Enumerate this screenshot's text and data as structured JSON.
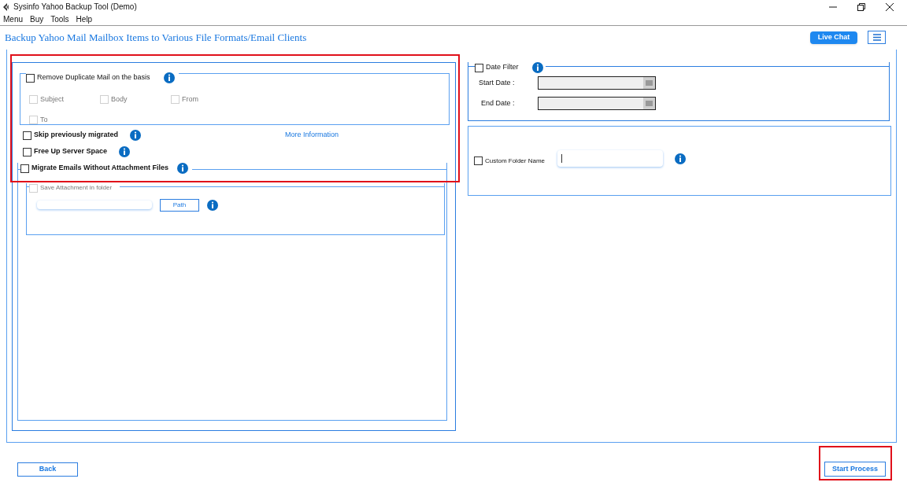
{
  "window": {
    "title": "Sysinfo Yahoo Backup Tool (Demo)"
  },
  "menu": [
    "Menu",
    "Buy",
    "Tools",
    "Help"
  ],
  "header": {
    "title": "Backup Yahoo Mail Mailbox Items to Various File Formats/Email Clients",
    "live_chat": "Live Chat"
  },
  "dedup": {
    "label": "Remove Duplicate Mail on the basis",
    "checked": false,
    "options": [
      {
        "label": "Subject",
        "checked": false,
        "disabled": true
      },
      {
        "label": "Body",
        "checked": false,
        "disabled": true
      },
      {
        "label": "From",
        "checked": false,
        "disabled": true
      },
      {
        "label": "To",
        "checked": false,
        "disabled": true
      }
    ]
  },
  "options": [
    {
      "label": "Skip previously migrated",
      "checked": false
    },
    {
      "label": "Free Up Server Space",
      "checked": false
    }
  ],
  "more_info": "More Information",
  "attachments": {
    "label": "Migrate Emails Without Attachment Files",
    "checked": false,
    "save_label": "Save Attachment in folder",
    "save_checked": false,
    "save_disabled": true,
    "path_button": "Path"
  },
  "date_filter": {
    "label": "Date Filter",
    "checked": false,
    "fields": [
      {
        "label": "Start Date :",
        "disabled": true
      },
      {
        "label": "End Date :",
        "disabled": true
      }
    ]
  },
  "custom_folder": {
    "label": "Custom Folder Name",
    "checked": false
  },
  "footer": {
    "back": "Back",
    "start": "Start Process"
  }
}
